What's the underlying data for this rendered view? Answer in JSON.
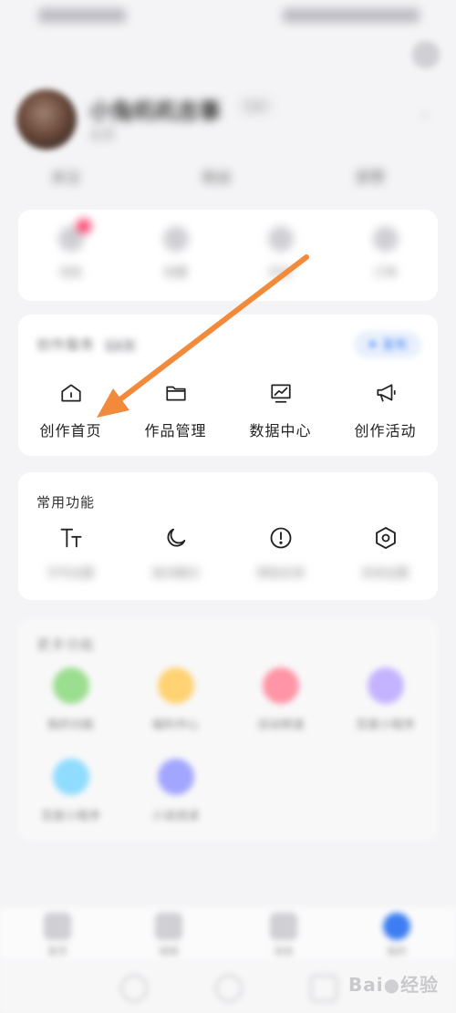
{
  "status_bar": {
    "left": "12:00",
    "right": "5G 100"
  },
  "header": {
    "settings_icon": "gear-icon"
  },
  "profile": {
    "name": "小兔叽叽吉事",
    "badge": "Lv",
    "subtitle": "主页",
    "chevron": "›"
  },
  "stats": [
    {
      "label": "关注"
    },
    {
      "label": "粉丝"
    },
    {
      "label": "获赞"
    }
  ],
  "quick_grid": [
    {
      "label": "消息",
      "has_badge": true,
      "badge_color": "#ff3b6b"
    },
    {
      "label": "收藏"
    },
    {
      "label": "历史"
    },
    {
      "label": "订单"
    }
  ],
  "creation_services": {
    "title": "创作服务",
    "level_badge": "Lv.0",
    "publish_label": "发布",
    "accent_color": "#3d7ef2",
    "items": [
      {
        "label": "创作首页",
        "icon": "home-icon"
      },
      {
        "label": "作品管理",
        "icon": "folder-icon"
      },
      {
        "label": "数据中心",
        "icon": "chart-monitor-icon"
      },
      {
        "label": "创作活动",
        "icon": "megaphone-icon"
      }
    ]
  },
  "common_functions": {
    "title": "常用功能",
    "items": [
      {
        "label": "字号设置",
        "icon": "text-size-icon"
      },
      {
        "label": "夜间模式",
        "icon": "moon-icon"
      },
      {
        "label": "帮助反馈",
        "icon": "alert-circle-icon"
      },
      {
        "label": "系统设置",
        "icon": "hexagon-settings-icon"
      }
    ]
  },
  "more_functions": {
    "title": "更多功能",
    "items": [
      {
        "label": "我的功能",
        "color": "#9bde8f"
      },
      {
        "label": "福利中心",
        "color": "#ffd272"
      },
      {
        "label": "活动频道",
        "color": "#ff95a6"
      },
      {
        "label": "百度小程序",
        "color": "#c4b3ff"
      },
      {
        "label": "百度小程序",
        "color": "#8fdcff"
      },
      {
        "label": "小说阅读",
        "color": "#a3a6ff"
      }
    ]
  },
  "bottom_nav": [
    {
      "label": "首页"
    },
    {
      "label": "视频"
    },
    {
      "label": "消息"
    },
    {
      "label": "我的",
      "active": true,
      "color": "#3d7ef2"
    }
  ],
  "watermark": {
    "brand": "Bai",
    "suffix": "经验"
  },
  "annotation": {
    "arrow_color": "#f28a3b"
  }
}
